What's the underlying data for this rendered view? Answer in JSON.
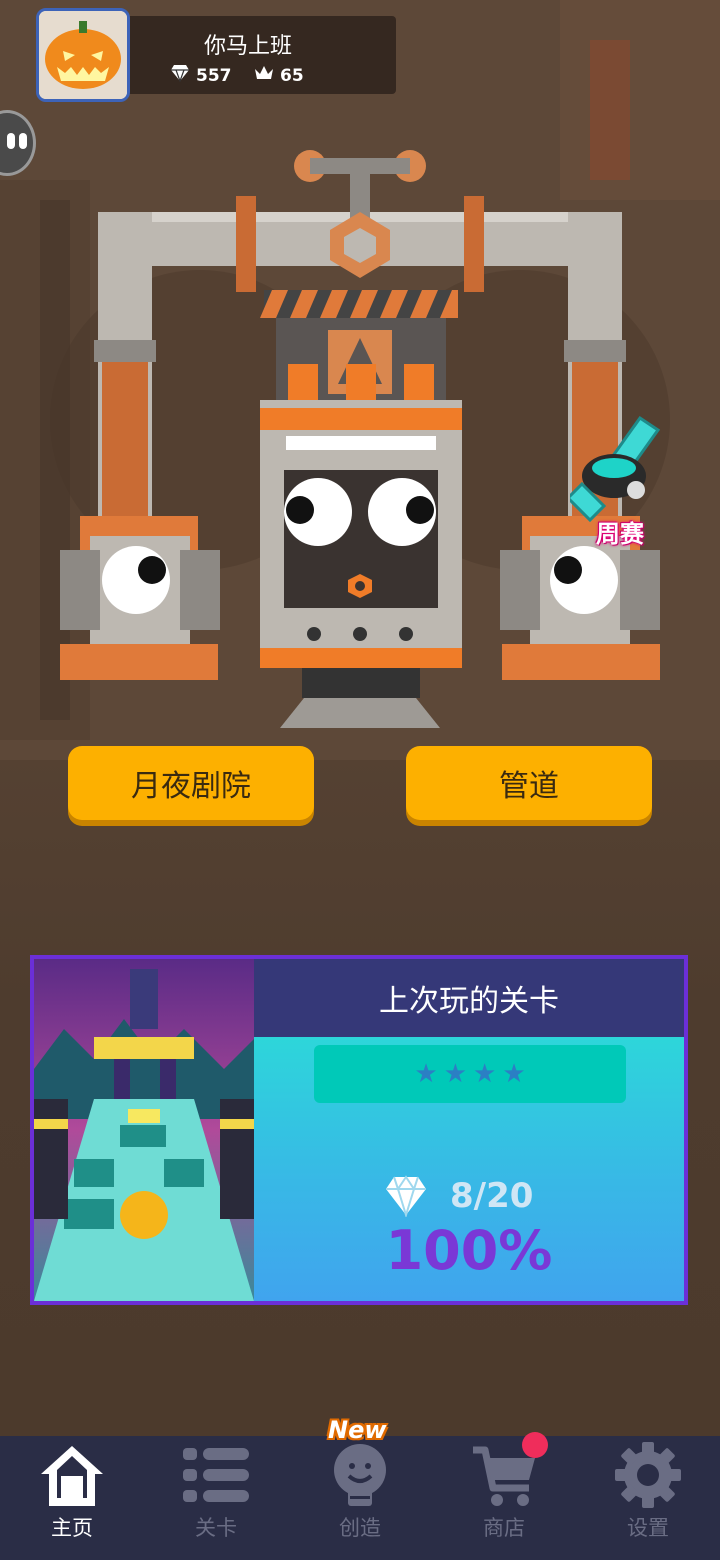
{
  "profile": {
    "username": "你马上班",
    "gems": "557",
    "crowns": "65"
  },
  "buttons": {
    "left": "月夜剧院",
    "right": "管道"
  },
  "weekly": {
    "label": "周赛"
  },
  "last_played": {
    "title": "上次玩的关卡",
    "stars": [
      "★",
      "★",
      "★",
      "★"
    ],
    "gems": "8/20",
    "percent": "100%"
  },
  "nav": {
    "items": [
      {
        "label": "主页",
        "icon": "home-icon",
        "active": true
      },
      {
        "label": "关卡",
        "icon": "list-icon",
        "active": false
      },
      {
        "label": "创造",
        "icon": "lightbulb-icon",
        "active": false,
        "badge": "New"
      },
      {
        "label": "商店",
        "icon": "cart-icon",
        "active": false,
        "dot": true
      },
      {
        "label": "设置",
        "icon": "gear-icon",
        "active": false
      }
    ]
  },
  "colors": {
    "accent": "#fdb000",
    "card_border": "#6b2fd8",
    "percent": "#7a38d6",
    "nav_bg": "#2a2d46",
    "notification": "#ef2d5b"
  }
}
